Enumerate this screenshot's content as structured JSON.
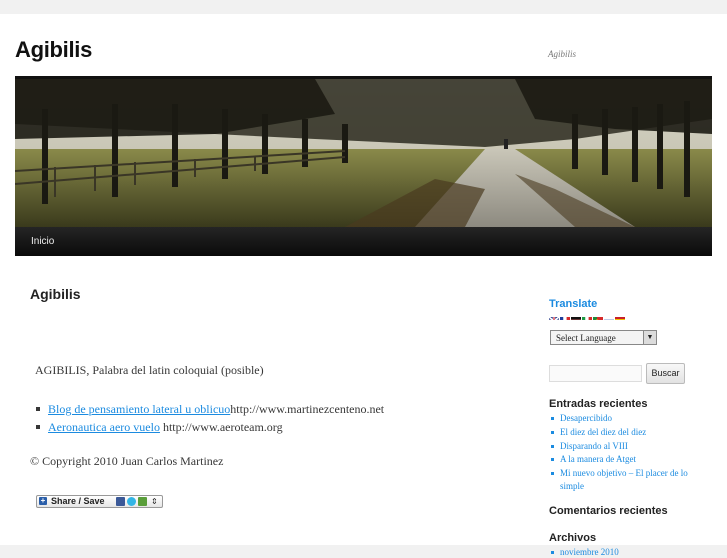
{
  "header": {
    "site_title": "Agibilis",
    "site_description": "Agibilis"
  },
  "nav": {
    "items": [
      {
        "label": "Inicio"
      }
    ]
  },
  "post": {
    "title": "Agibilis",
    "intro": "AGIBILIS, Palabra del latin coloquial (posible)",
    "links": [
      {
        "link_text": "Blog de pensamiento lateral u oblicuo",
        "url_text": "http://www.martinezcenteno.net"
      },
      {
        "link_text": "Aeronautica aero vuelo",
        "url_text": " http://www.aeroteam.org"
      }
    ],
    "copyright": "© Copyright 2010 Juan Carlos Martinez",
    "share_label": "Share / Save"
  },
  "sidebar": {
    "translate": {
      "title": "Translate",
      "select_label": "Select Language"
    },
    "search": {
      "placeholder": "",
      "button_label": "Buscar"
    },
    "recent_posts": {
      "title": "Entradas recientes",
      "items": [
        "Desapercibido",
        "El diez del diez del diez",
        "Disparando al VIII",
        "A la manera de Atget",
        "Mi nuevo objetivo – El placer de lo simple"
      ]
    },
    "comments": {
      "title": "Comentarios recientes"
    },
    "archives": {
      "title": "Archivos",
      "items": [
        "noviembre 2010"
      ]
    }
  },
  "colors": {
    "link": "#1b8be0",
    "nav_background": "#111111",
    "page_background": "#ffffff",
    "outer_background": "#f1f1f1"
  }
}
